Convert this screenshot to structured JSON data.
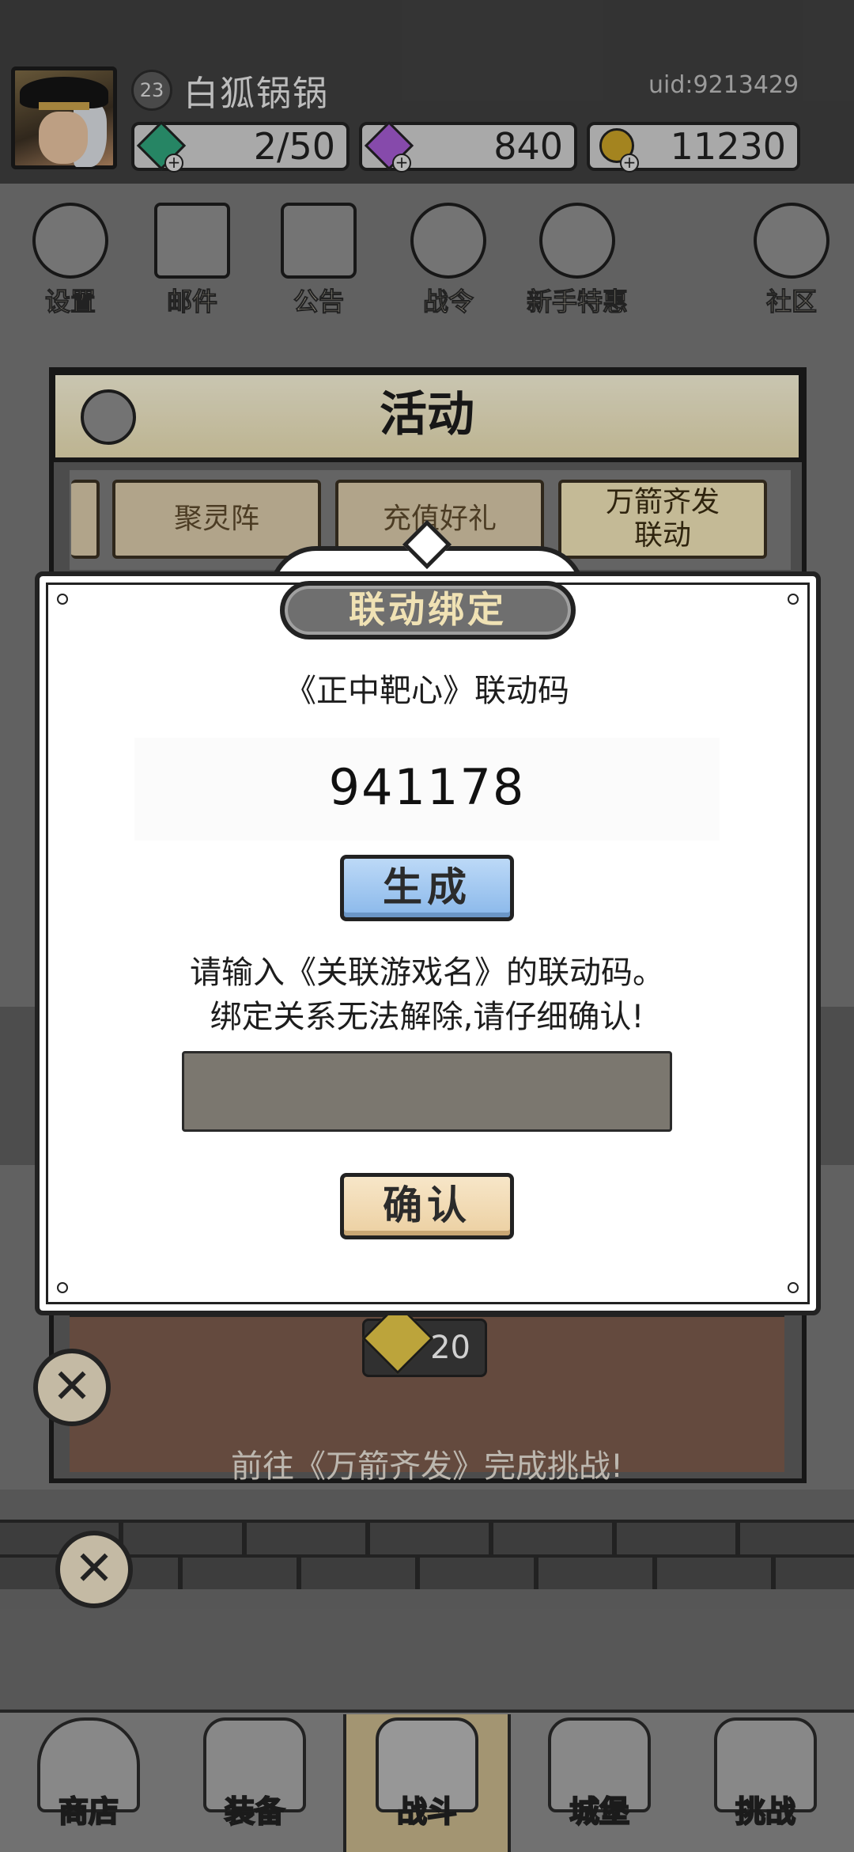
{
  "player": {
    "level": "23",
    "name": "白狐锅锅",
    "uid": "uid:9213429"
  },
  "resources": [
    {
      "name": "stamina",
      "value": "2/50",
      "color": "#2fa37b"
    },
    {
      "name": "diamond",
      "value": "840",
      "color": "#a45bd1"
    },
    {
      "name": "gold",
      "value": "11230",
      "color": "#c9a227"
    }
  ],
  "top_menu": {
    "settings": "设置",
    "mail": "邮件",
    "notice": "公告",
    "battle_pass": "战令",
    "newbie_offer": "新手特惠",
    "community": "社区"
  },
  "activity": {
    "title": "活动",
    "tabs": [
      {
        "label": "聚灵阵"
      },
      {
        "label": "充值好礼"
      },
      {
        "label": "万箭齐发\n联动"
      }
    ],
    "reward_count": "20",
    "reward_caption": "前往《万箭齐发》完成挑战!"
  },
  "dialog": {
    "title": "联动绑定",
    "game_line": "《正中靶心》联动码",
    "code": "941178",
    "generate_label": "生成",
    "hint_line1": "请输入《关联游戏名》的联动码。",
    "hint_line2": "绑定关系无法解除,请仔细确认!",
    "input_value": "",
    "input_placeholder": "",
    "confirm_label": "确认"
  },
  "bottom_nav": [
    {
      "label": "商店"
    },
    {
      "label": "装备"
    },
    {
      "label": "战斗"
    },
    {
      "label": "城堡"
    },
    {
      "label": "挑战"
    }
  ]
}
